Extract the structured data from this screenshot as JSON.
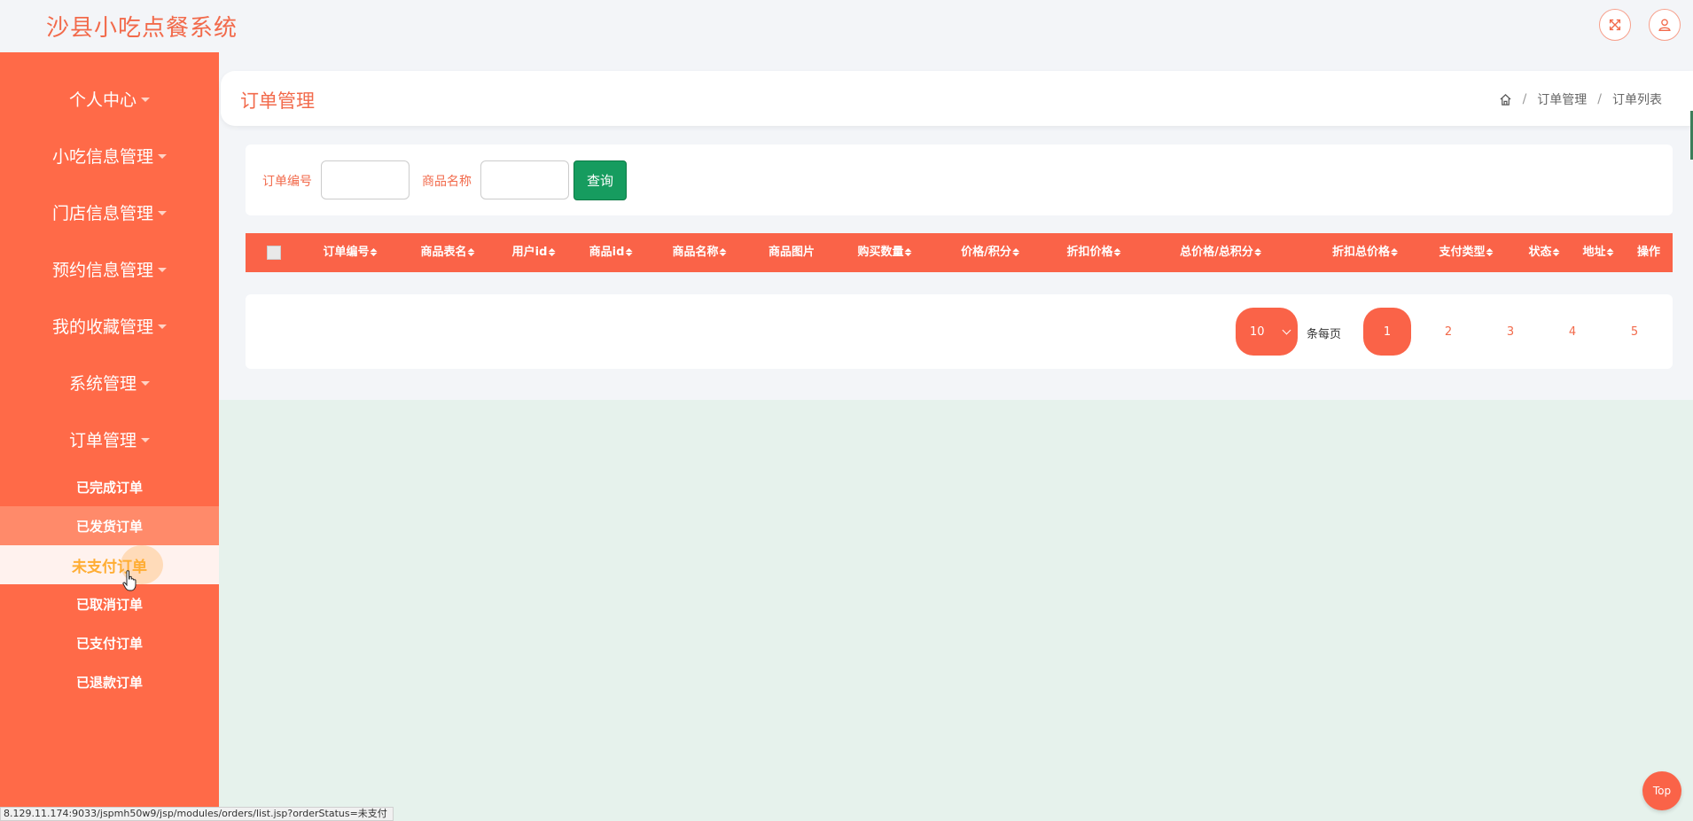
{
  "app": {
    "title": "沙县小吃点餐系统"
  },
  "header": {
    "icons": [
      "fullscreen-icon",
      "user-icon"
    ]
  },
  "sidebar": {
    "menus": [
      {
        "label": "个人中心"
      },
      {
        "label": "小吃信息管理"
      },
      {
        "label": "门店信息管理"
      },
      {
        "label": "预约信息管理"
      },
      {
        "label": "我的收藏管理"
      },
      {
        "label": "系统管理"
      },
      {
        "label": "订单管理"
      }
    ],
    "order_submenu": [
      {
        "label": "已完成订单"
      },
      {
        "label": "已发货订单"
      },
      {
        "label": "未支付订单"
      },
      {
        "label": "已取消订单"
      },
      {
        "label": "已支付订单"
      },
      {
        "label": "已退款订单"
      }
    ],
    "active_item": "未支付订单",
    "hover_item": "已发货订单",
    "accent_color": "#ff6a48",
    "active_text_color": "#ffad33"
  },
  "page": {
    "title": "订单管理",
    "breadcrumb": [
      "订单管理",
      "订单列表"
    ]
  },
  "search": {
    "order_no_label": "订单编号",
    "order_no_value": "",
    "product_name_label": "商品名称",
    "product_name_value": "",
    "query_button": "查询",
    "query_button_color": "#169c5f"
  },
  "table": {
    "header_color": "#fa6348",
    "columns": [
      {
        "label": "订单编号",
        "sortable": true
      },
      {
        "label": "商品表名",
        "sortable": true
      },
      {
        "label": "用户id",
        "sortable": true
      },
      {
        "label": "商品id",
        "sortable": true
      },
      {
        "label": "商品名称",
        "sortable": true
      },
      {
        "label": "商品图片",
        "sortable": false
      },
      {
        "label": "购买数量",
        "sortable": true
      },
      {
        "label": "价格/积分",
        "sortable": true
      },
      {
        "label": "折扣价格",
        "sortable": true
      },
      {
        "label": "总价格/总积分",
        "sortable": true
      },
      {
        "label": "折扣总价格",
        "sortable": true
      },
      {
        "label": "支付类型",
        "sortable": true
      },
      {
        "label": "状态",
        "sortable": true
      },
      {
        "label": "地址",
        "sortable": true
      },
      {
        "label": "操作",
        "sortable": false
      }
    ],
    "rows": []
  },
  "pagination": {
    "page_size": "10",
    "per_page_label": "条每页",
    "pages": [
      "1",
      "2",
      "3",
      "4",
      "5"
    ],
    "current_page": "1"
  },
  "back_to_top": "Top",
  "status_bar_url": "8.129.11.174:9033/jspmh50w9/jsp/modules/orders/list.jsp?orderStatus=未支付"
}
